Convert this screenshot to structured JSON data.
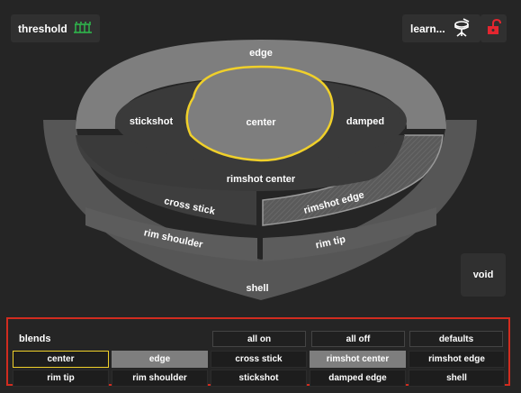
{
  "header": {
    "threshold_label": "threshold",
    "learn_label": "learn...",
    "lock_icon_color": "#e3262f",
    "threshold_icon_color": "#2fbd4d"
  },
  "pad": {
    "edge": "edge",
    "stickshot": "stickshot",
    "center": "center",
    "damped": "damped",
    "rimshot_center": "rimshot center",
    "cross_stick": "cross stick",
    "rimshot_edge": "rimshot edge",
    "rim_shoulder": "rim shoulder",
    "rim_tip": "rim tip",
    "shell": "shell",
    "void": "void",
    "selected_zone": "center",
    "selected_color": "#f0d02a"
  },
  "blends": {
    "title": "blends",
    "all_on": "all on",
    "all_off": "all off",
    "defaults": "defaults",
    "buttons": [
      {
        "label": "center",
        "state": "outlined"
      },
      {
        "label": "edge",
        "state": "selected"
      },
      {
        "label": "cross stick",
        "state": "normal"
      },
      {
        "label": "rimshot center",
        "state": "selected"
      },
      {
        "label": "rimshot edge",
        "state": "normal"
      },
      {
        "label": "rim tip",
        "state": "normal"
      },
      {
        "label": "rim shoulder",
        "state": "normal"
      },
      {
        "label": "stickshot",
        "state": "normal"
      },
      {
        "label": "damped edge",
        "state": "normal"
      },
      {
        "label": "shell",
        "state": "normal"
      }
    ]
  }
}
